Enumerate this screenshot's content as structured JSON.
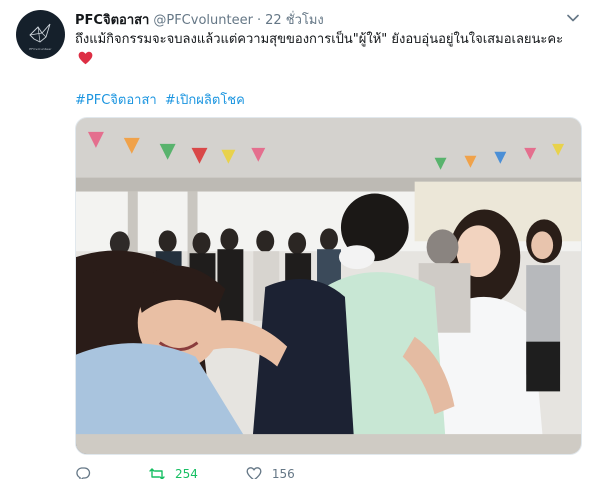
{
  "author": {
    "display_name": "PFCจิตอาสา",
    "handle": "@PFCvolunteer",
    "time": "22 ชั่วโมง",
    "avatar_caption": "PFCvolunteer"
  },
  "tweet": {
    "text": "ถึงแม้กิจกรรมจะจบลงแล้วแต่ความสุขของการเป็น\"ผู้ให้\" ยังอบอุ่นอยู่ในใจเสมอเลยนะคะ",
    "emoji": "red-heart",
    "hashtags": [
      "#PFCจิตอาสา",
      "#เปิกผลิตโชค"
    ]
  },
  "media": {
    "type": "photo",
    "description_icon": "photo"
  },
  "actions": {
    "reply_count": "",
    "retweet_count": "254",
    "like_count": "156"
  },
  "colors": {
    "link": "#1b95e0",
    "retweet_active": "#17bf63",
    "muted": "#657786",
    "heart": "#e0245e"
  }
}
